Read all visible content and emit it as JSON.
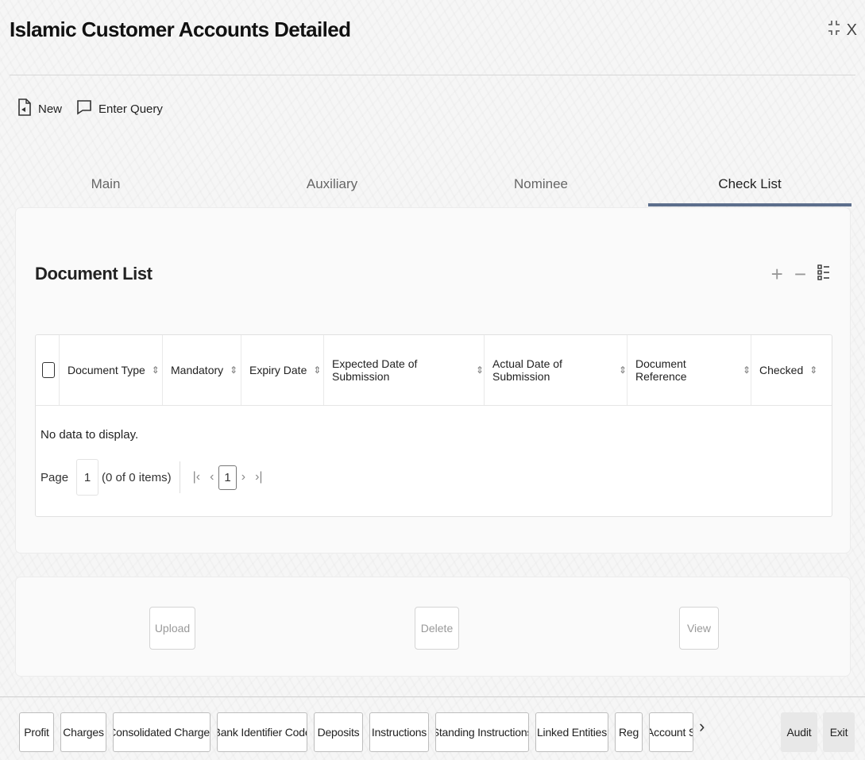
{
  "window": {
    "title": "Islamic Customer Accounts Detailed",
    "close_label": "X"
  },
  "toolbar": {
    "new_label": "New",
    "enter_query_label": "Enter Query"
  },
  "tabs": [
    {
      "label": "Main"
    },
    {
      "label": "Auxiliary"
    },
    {
      "label": "Nominee"
    },
    {
      "label": "Check List"
    }
  ],
  "document_list": {
    "title": "Document List",
    "columns": [
      "Document Type",
      "Mandatory",
      "Expiry Date",
      "Expected Date of Submission",
      "Actual Date of Submission",
      "Document Reference",
      "Checked"
    ],
    "empty_text": "No data to display.",
    "pager": {
      "page_label": "Page",
      "page_value": "1",
      "items_text": "(0 of 0 items)",
      "current_page": "1"
    }
  },
  "actions": {
    "upload_label": "Upload",
    "delete_label": "Delete",
    "view_label": "View"
  },
  "footer": {
    "buttons": [
      "Profit",
      "Charges",
      "Consolidated Charges",
      "Bank Identifier Code",
      "Deposits",
      "Instructions",
      "Standing Instructions",
      "Linked Entities",
      "Reg",
      "Account S"
    ],
    "audit_label": "Audit",
    "exit_label": "Exit"
  }
}
